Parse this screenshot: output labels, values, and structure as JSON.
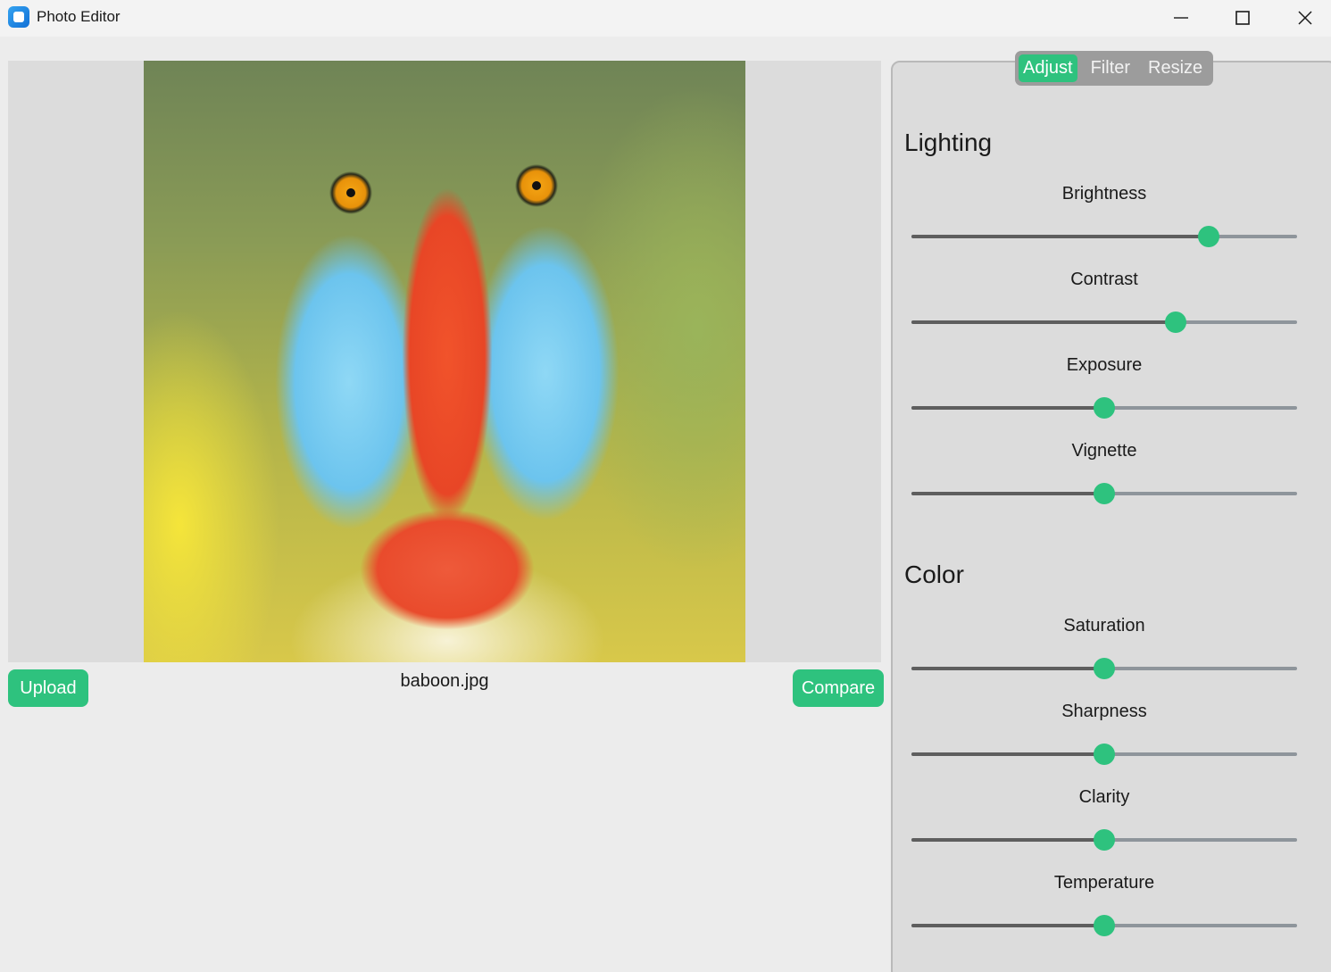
{
  "window": {
    "title": "Photo Editor",
    "controls": [
      "minimize-icon",
      "maximize-icon",
      "close-icon"
    ]
  },
  "image": {
    "filename": "baboon.jpg"
  },
  "buttons": {
    "upload": "Upload",
    "compare": "Compare"
  },
  "tabs": [
    {
      "label": "Adjust",
      "active": true
    },
    {
      "label": "Filter",
      "active": false
    },
    {
      "label": "Resize",
      "active": false
    }
  ],
  "sections": {
    "lighting": {
      "title": "Lighting",
      "sliders": [
        {
          "label": "Brightness",
          "value": 0.77
        },
        {
          "label": "Contrast",
          "value": 0.685
        },
        {
          "label": "Exposure",
          "value": 0.5
        },
        {
          "label": "Vignette",
          "value": 0.5
        }
      ]
    },
    "color": {
      "title": "Color",
      "sliders": [
        {
          "label": "Saturation",
          "value": 0.5
        },
        {
          "label": "Sharpness",
          "value": 0.5
        },
        {
          "label": "Clarity",
          "value": 0.5
        },
        {
          "label": "Temperature",
          "value": 0.5
        }
      ]
    }
  },
  "colors": {
    "accent": "#2ec27e",
    "track": "#8e959b",
    "track_fill": "#5e5e5e",
    "panel": "#dcdcdc",
    "background": "#ececec"
  }
}
